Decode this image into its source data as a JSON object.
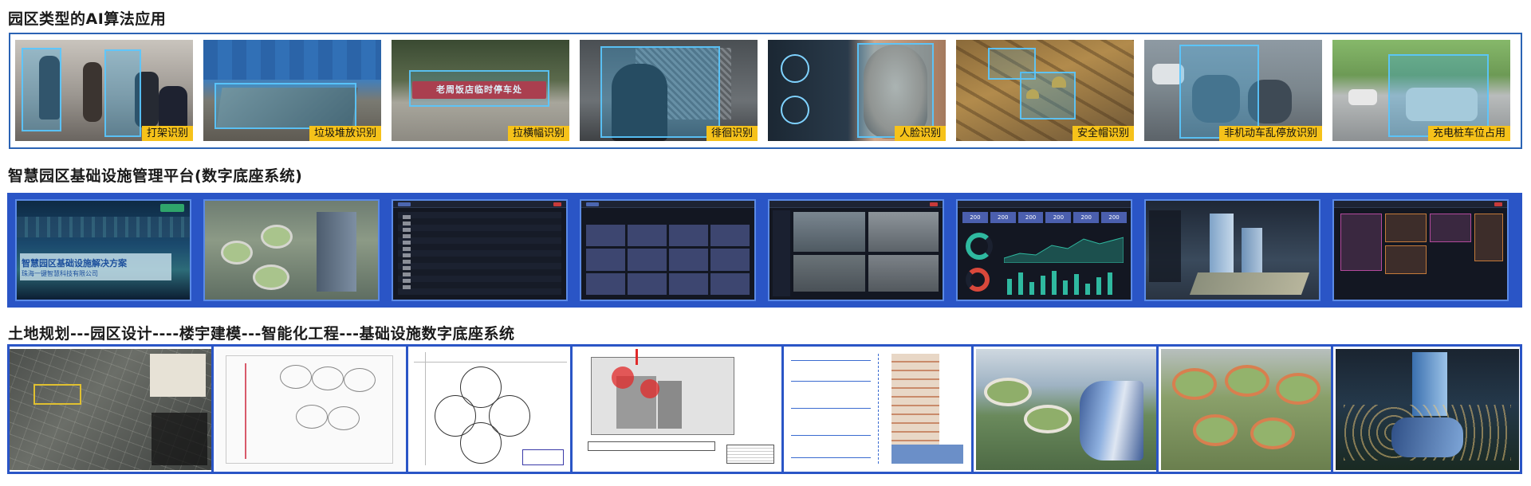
{
  "section1": {
    "title": "园区类型的AI算法应用",
    "cards": [
      {
        "label": "打架识别",
        "icon": "fight-scene"
      },
      {
        "label": "垃圾堆放识别",
        "icon": "garbage-scene"
      },
      {
        "label": "拉横幅识别",
        "icon": "banner-scene"
      },
      {
        "label": "徘徊识别",
        "icon": "loitering-scene"
      },
      {
        "label": "人脸识别",
        "icon": "face-scene"
      },
      {
        "label": "安全帽识别",
        "icon": "helmet-scene"
      },
      {
        "label": "非机动车乱停放识别",
        "icon": "bike-parking-scene"
      },
      {
        "label": "充电桩车位占用",
        "icon": "charging-spot-scene"
      }
    ],
    "banner_text": "老周饭店临时停车处"
  },
  "section2": {
    "title": "智慧园区基础设施管理平台(数字底座系统)",
    "cover": {
      "heading": "智慧园区基础设施解决方案",
      "company": "珠海一键智慧科技有限公司"
    },
    "screens": [
      "cover-slide",
      "3d-campus-model",
      "device-table",
      "camera-grid",
      "video-monitor",
      "statistics-dashboard",
      "building-3d-view",
      "alarm-panel"
    ],
    "dashboard_stats": [
      "200",
      "200",
      "200",
      "200",
      "200",
      "200"
    ],
    "accent_color": "#2a55c6"
  },
  "section3": {
    "title": "土地规划---园区设计----楼宇建模---智能化工程---基础设施数字底座系统",
    "panels": [
      "land-planning-map",
      "campus-site-plan",
      "clover-floor-plan",
      "building-floor-layout",
      "building-section-elevation",
      "campus-rendering-day",
      "campus-rendering-aerial",
      "campus-rendering-night"
    ]
  }
}
